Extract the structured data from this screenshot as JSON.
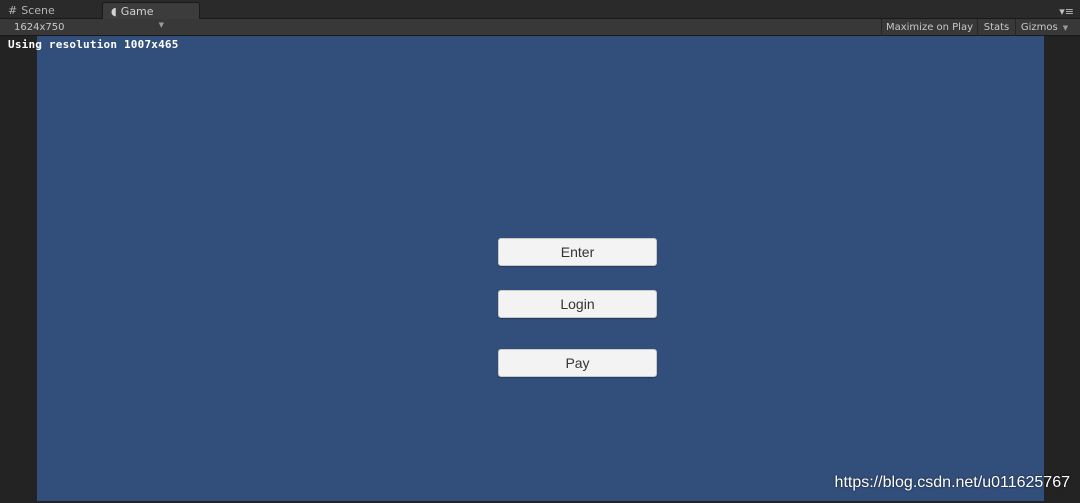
{
  "tabs": [
    {
      "label": "Scene",
      "icon": "grid-icon"
    },
    {
      "label": "Game",
      "icon": "pacman-icon"
    }
  ],
  "toolbar": {
    "resolution": "1624x750",
    "maximize_label": "Maximize on Play",
    "stats_label": "Stats",
    "gizmos_label": "Gizmos"
  },
  "game_view": {
    "info_text": "Using resolution 1007x465",
    "background_color": "#324f7b",
    "buttons": {
      "enter": "Enter",
      "login": "Login",
      "pay": "Pay"
    }
  },
  "watermark": "https://blog.csdn.net/u011625767"
}
